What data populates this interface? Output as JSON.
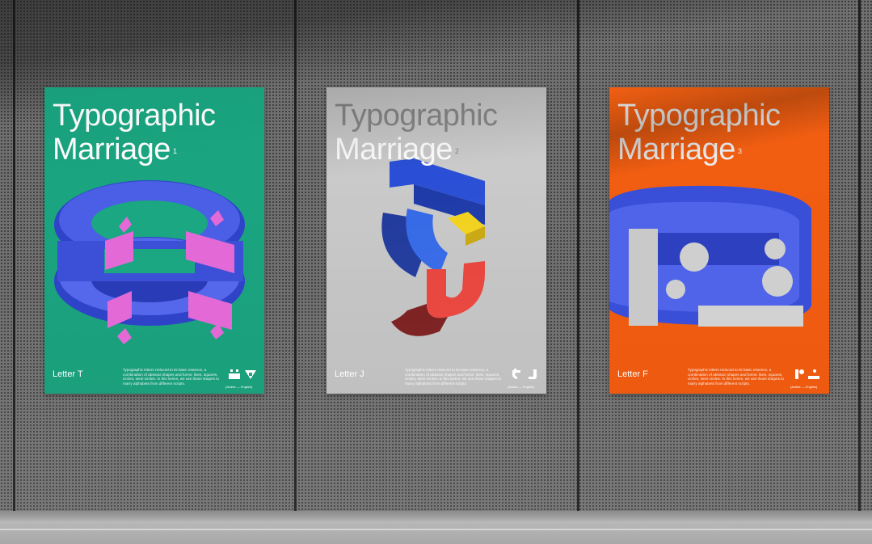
{
  "posters": [
    {
      "title_line1": "Typographic",
      "title_line2": "Marriage",
      "number": "1",
      "letter": "Letter T",
      "description": "Typographic letters reduced to its basic essence, a combination of abstract shapes and forms: lines, squares, circles, semi-circles. In this series, we use those shapes to marry alphabets from different scripts.",
      "languages": "(Arabic — English)",
      "color": "#1aa782"
    },
    {
      "title_line1": "Typographic",
      "title_line2": "Marriage",
      "number": "2",
      "letter": "Letter J",
      "description": "Typographic letters reduced to its basic essence, a combination of abstract shapes and forms: lines, squares, circles, semi-circles. In this series, we use those shapes to marry alphabets from different scripts.",
      "languages": "(Arabic — English)",
      "color": "#c8c8c8"
    },
    {
      "title_line1": "Typographic",
      "title_line2": "Marriage",
      "number": "3",
      "letter": "Letter F",
      "description": "Typographic letters reduced to its basic essence, a combination of abstract shapes and forms: lines, squares, circles, semi-circles. In this series, we use those shapes to marry alphabets from different scripts.",
      "languages": "(Arabic — English)",
      "color": "#f25f12"
    }
  ],
  "colors": {
    "blue": "#3a4fd8",
    "pink": "#e36ad6",
    "red": "#e8433b",
    "yellow": "#f1d21e",
    "dark_red": "#6b1a1a",
    "light_grey": "#cfcfcf"
  }
}
